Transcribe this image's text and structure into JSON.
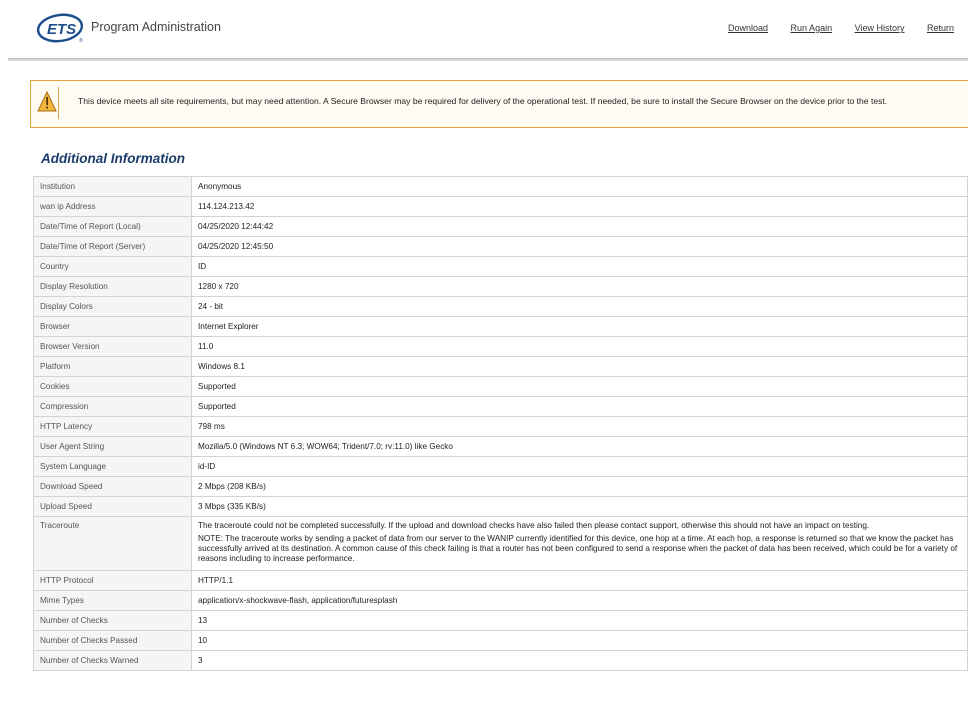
{
  "header": {
    "logo_text": "ETS",
    "logo_mark": "®",
    "title": "Program Administration",
    "nav": [
      {
        "label": "Download"
      },
      {
        "label": "Run Again"
      },
      {
        "label": "View History"
      },
      {
        "label": "Return"
      }
    ]
  },
  "notice": {
    "icon": "warning-triangle-icon",
    "text": "This device meets all site requirements, but may need attention. A Secure Browser may be required for delivery of the operational test. If needed, be sure to install the Secure Browser on the device prior to the test."
  },
  "section": {
    "title": "Additional Information"
  },
  "rows": [
    {
      "label": "Institution",
      "value": "Anonymous"
    },
    {
      "label": "wan ip Address",
      "value": "114.124.213.42"
    },
    {
      "label": "Date/Time of Report (Local)",
      "value": "04/25/2020 12:44:42"
    },
    {
      "label": "Date/Time of Report (Server)",
      "value": "04/25/2020 12:45:50"
    },
    {
      "label": "Country",
      "value": "ID"
    },
    {
      "label": "Display Resolution",
      "value": "1280 x 720"
    },
    {
      "label": "Display Colors",
      "value": "24 - bit"
    },
    {
      "label": "Browser",
      "value": "Internet Explorer"
    },
    {
      "label": "Browser Version",
      "value": "11.0"
    },
    {
      "label": "Platform",
      "value": "Windows 8.1"
    },
    {
      "label": "Cookies",
      "value": "Supported"
    },
    {
      "label": "Compression",
      "value": "Supported"
    },
    {
      "label": "HTTP Latency",
      "value": "798 ms"
    },
    {
      "label": "User Agent String",
      "value": "Mozilla/5.0 (Windows NT 6.3; WOW64; Trident/7.0; rv:11.0) like Gecko"
    },
    {
      "label": "System Language",
      "value": "id-ID"
    },
    {
      "label": "Download Speed",
      "value": "2 Mbps (208 KB/s)"
    },
    {
      "label": "Upload Speed",
      "value": "3 Mbps (335 KB/s)"
    },
    {
      "label": "Traceroute",
      "value": "The traceroute could not be completed successfully. If the upload and download checks have also failed then please contact support, otherwise this should not have an impact on testing.",
      "note": "NOTE: The traceroute works by sending a packet of data from our server to the WANIP currently identified for this device, one hop at a time. At each hop, a response is returned so that we know the packet has successfully arrived at its destination. A common cause of this check failing is that a router has not been configured to send a response when the packet of data has been received, which could be for a variety of reasons including to increase performance."
    },
    {
      "label": "HTTP Protocol",
      "value": "HTTP/1.1"
    },
    {
      "label": "Mime Types",
      "value": "application/x-shockwave-flash, application/futuresplash"
    },
    {
      "label": "Number of Checks",
      "value": "13"
    },
    {
      "label": "Number of Checks Passed",
      "value": "10"
    },
    {
      "label": "Number of Checks Warned",
      "value": "3"
    }
  ],
  "colors": {
    "accent": "#1b3c6b",
    "warning": "#e3a341"
  }
}
